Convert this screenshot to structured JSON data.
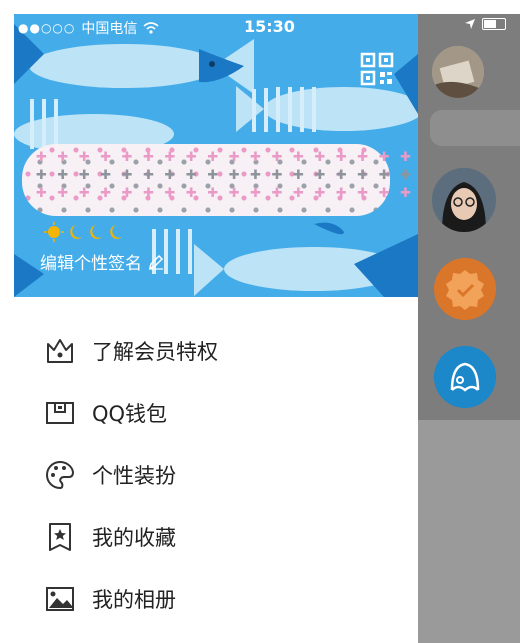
{
  "status_bar": {
    "signal": "●●○○○",
    "carrier": "中国电信",
    "wifi_icon": "wifi-icon",
    "time": "15:30",
    "location_icon": "location-arrow-icon",
    "battery_icon": "battery-icon"
  },
  "header": {
    "level_icons": "🌞🌙🌙🌙",
    "signature_label": "编辑个性签名",
    "edit_icon": "pencil-icon",
    "qr_icon": "qr-code-icon",
    "nickname_pattern": "✚"
  },
  "menu": {
    "items": [
      {
        "label": "了解会员特权",
        "icon": "crown-icon"
      },
      {
        "label": "QQ钱包",
        "icon": "wallet-icon"
      },
      {
        "label": "个性装扮",
        "icon": "palette-icon"
      },
      {
        "label": "我的收藏",
        "icon": "star-bookmark-icon"
      },
      {
        "label": "我的相册",
        "icon": "photo-album-icon"
      }
    ]
  },
  "colors": {
    "header_bg": "#3fa8e6",
    "fish_dark": "#1b78c4",
    "overlay": "#7d7d7d",
    "badge_orange": "#d9762a",
    "badge_blue": "#1c87c9"
  }
}
